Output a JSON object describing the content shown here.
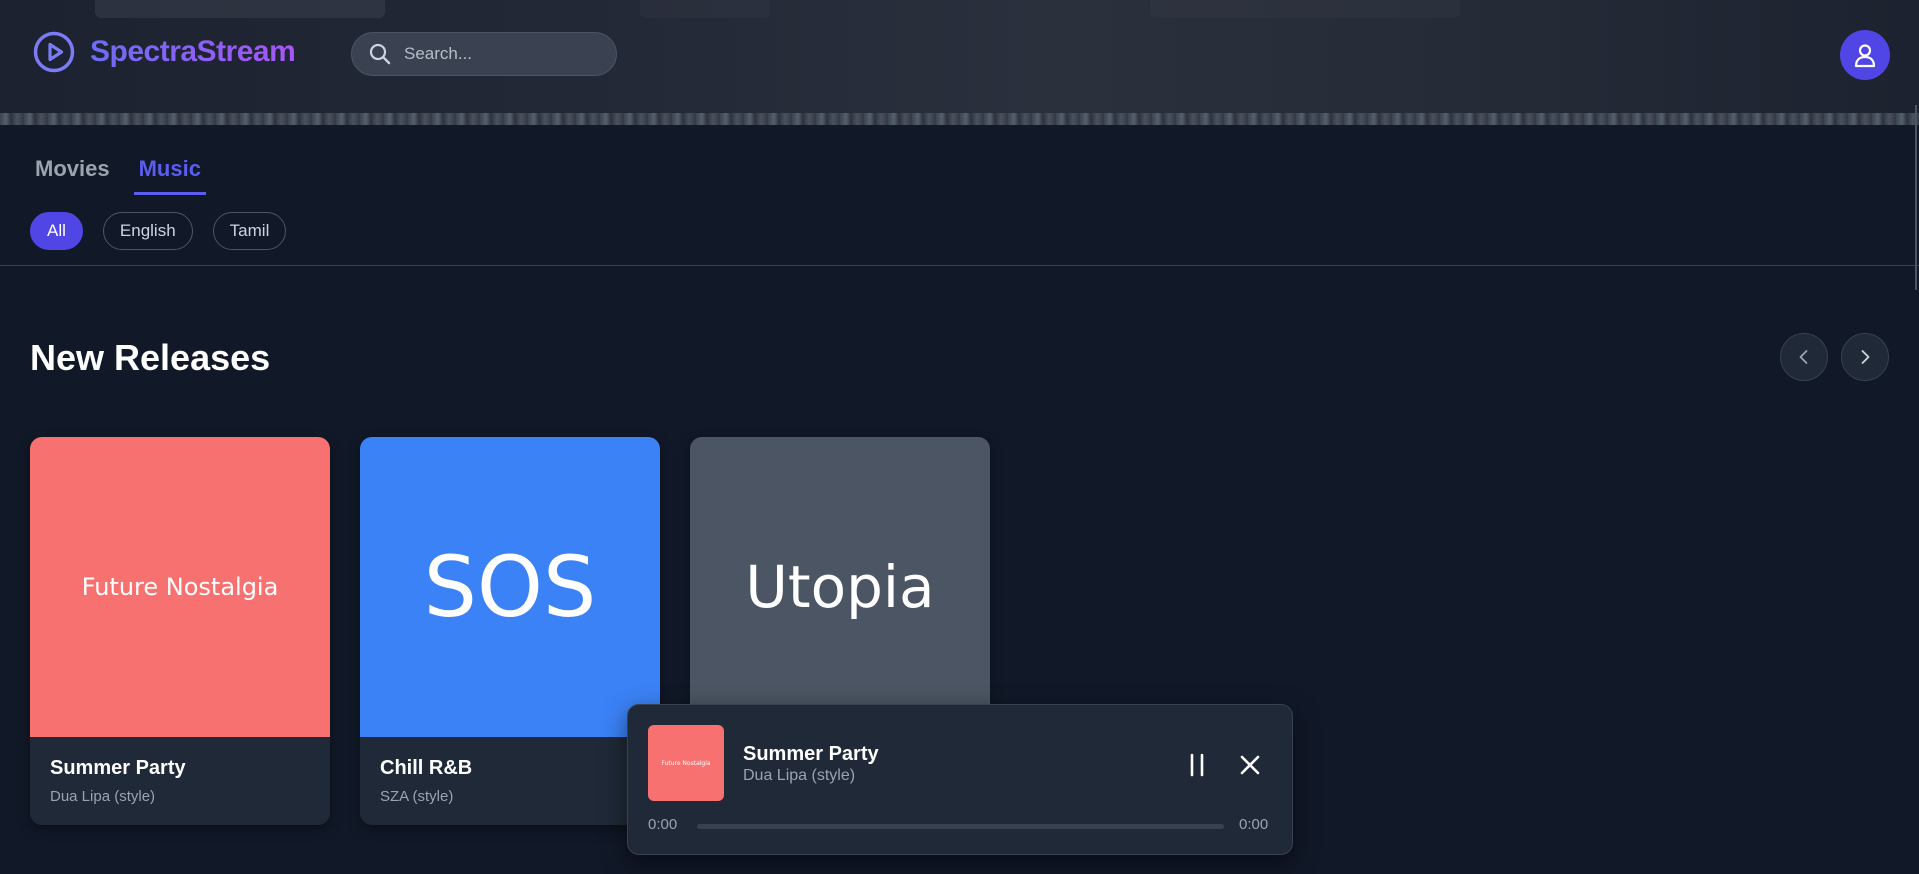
{
  "app": {
    "name": "SpectraStream",
    "logo_icon": "play-circle-icon",
    "accent": "#4f46e5"
  },
  "search": {
    "placeholder": "Search...",
    "value": "",
    "icon": "search-icon"
  },
  "header": {
    "avatar_icon": "user-icon"
  },
  "tabs": [
    {
      "label": "Movies",
      "active": false
    },
    {
      "label": "Music",
      "active": true
    }
  ],
  "filters": [
    {
      "label": "All",
      "active": true
    },
    {
      "label": "English",
      "active": false
    },
    {
      "label": "Tamil",
      "active": false
    }
  ],
  "section": {
    "title": "New Releases",
    "prev_icon": "chevron-left-icon",
    "next_icon": "chevron-right-icon"
  },
  "cards": [
    {
      "art_text": "Future Nostalgia",
      "art_color": "#f87171",
      "title": "Summer Party",
      "artist": "Dua Lipa (style)"
    },
    {
      "art_text": "SOS",
      "art_color": "#3b82f6",
      "title": "Chill R&B",
      "artist": "SZA (style)"
    },
    {
      "art_text": "Utopia",
      "art_color": "#4b5563",
      "title": "",
      "artist": ""
    }
  ],
  "player": {
    "thumb_text": "Future Nostalgia",
    "thumb_color": "#f87171",
    "title": "Summer Party",
    "artist": "Dua Lipa (style)",
    "current_time": "0:00",
    "duration": "0:00",
    "progress": 0,
    "pause_icon": "pause-icon",
    "close_icon": "close-icon"
  }
}
